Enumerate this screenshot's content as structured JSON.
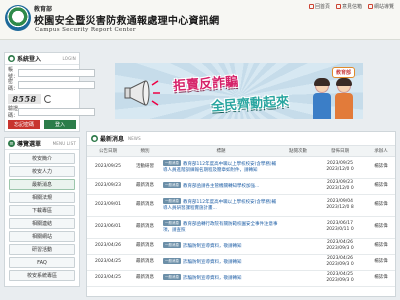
{
  "header": {
    "org": "教育部",
    "title": "校園安全暨災害防救通報處理中心資訊網",
    "title_en": "Campus Security Report Center",
    "links": [
      "回首頁",
      "意見信箱",
      "網站導覽"
    ]
  },
  "login": {
    "title": "系統登入",
    "title_en": "LOGIN",
    "account_label": "帳號：",
    "password_label": "密碼：",
    "captcha_label": "驗證碼：",
    "captcha_code": "8558",
    "forgot_label": "忘記密碼",
    "login_label": "登入"
  },
  "menu": {
    "title": "導覽選單",
    "title_en": "MENU LIST",
    "items": [
      "校安簡介",
      "校安人力",
      "最新消息",
      "相關法規",
      "下載專區",
      "相關連結",
      "相關網站",
      "研習活動",
      "FAQ",
      "校安系統專區"
    ]
  },
  "banner": {
    "line1": "拒賣反詐騙",
    "line2": "全民齊動起來",
    "badge": "教育部"
  },
  "news": {
    "title": "最新消息",
    "title_en": "NEWS",
    "columns": [
      "公告日期",
      "類別",
      "標題",
      "點閱次數",
      "發佈日期",
      "承辦人"
    ],
    "rows": [
      {
        "date": "2023/09/25",
        "category": "活動研習",
        "tag": "一般消息",
        "title": "教育部112年度高中職以上學校校安(含學務)輔導人員進階訓練報名期程及簡章如附件，請轉知",
        "views": "",
        "publish": "2023/09/25 2023/12/0 0",
        "officer": "楊誌偉"
      },
      {
        "date": "2023/09/23",
        "category": "最新消息",
        "tag": "一般消息",
        "title": "教育部函請各主管機關轉知學校加強...",
        "views": "",
        "publish": "2023/09/23 2023/12/0 0",
        "officer": "楊誌偉"
      },
      {
        "date": "2023/09/01",
        "category": "最新消息",
        "tag": "一般消息",
        "title": "教育部112年度高中職以上學校校安(含學務)輔導人員研習課程實施計畫...",
        "views": "",
        "publish": "2023/09/04 2023/12/0 8",
        "officer": "楊誌偉"
      },
      {
        "date": "2023/06/01",
        "category": "最新消息",
        "tag": "一般消息",
        "title": "教育部函轉行政院有關防範校園安全事件注意事項，請查照",
        "views": "",
        "publish": "2023/06/17 2023/0/11 0",
        "officer": "楊誌偉"
      },
      {
        "date": "2023/04/26",
        "category": "最新消息",
        "tag": "一般消息",
        "title": "詐騙防制宣導資料，敬請轉知",
        "views": "",
        "publish": "2023/04/26 2023/09/3 0",
        "officer": "楊誌偉"
      },
      {
        "date": "2023/04/25",
        "category": "最新消息",
        "tag": "一般消息",
        "title": "詐騙防制宣導資料，敬請轉知",
        "views": "",
        "publish": "2023/04/26 2023/09/3 0",
        "officer": "楊誌偉"
      },
      {
        "date": "2023/04/25",
        "category": "最新消息",
        "tag": "一般消息",
        "title": "詐騙防制宣導資料，敬請轉知",
        "views": "",
        "publish": "2023/04/25 2023/09/3 0",
        "officer": "楊誌偉"
      }
    ]
  }
}
